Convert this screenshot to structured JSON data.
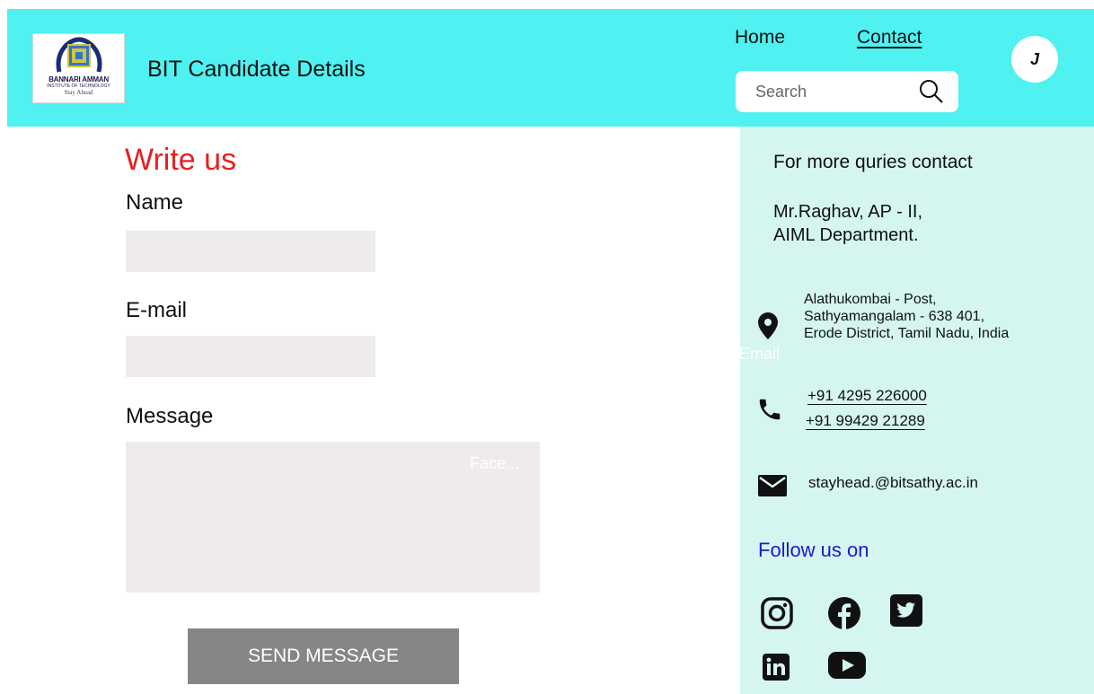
{
  "header": {
    "logo": {
      "line1": "BANNARI AMMAN",
      "line2": "INSTITUTE OF TECHNOLOGY",
      "line3": "Stay Ahead"
    },
    "title": "BIT Candidate Details",
    "nav": {
      "home": "Home",
      "contact": "Contact"
    },
    "avatar_initial": "J",
    "search": {
      "placeholder": "Search",
      "value": ""
    },
    "background_color": "#4ff1f1"
  },
  "form": {
    "title": "Write us",
    "name_label": "Name",
    "email_label": "E-mail",
    "message_label": "Message",
    "name_value": "",
    "email_value": "",
    "message_value": "",
    "message_overlay_text": "Face...",
    "submit_label": "SEND MESSAGE",
    "title_color": "#e8201f",
    "field_color": "#efebeb",
    "button_color": "#868686"
  },
  "contact": {
    "heading": "For more quries contact",
    "person_line1": "Mr.Raghav, AP - II,",
    "person_line2": "AIML Department.",
    "address_line1": "Alathukombai - Post,",
    "address_line2": "Sathyamangalam - 638 401,",
    "address_line3": "Erode District, Tamil Nadu, India",
    "email_overlay_text": "Email",
    "phone1": "+91 4295 226000",
    "phone2": "+91 99429 21289",
    "email": "stayhead.@bitsathy.ac.in",
    "follow_label": "Follow us on",
    "panel_color": "#d4f5f0",
    "follow_color": "#1a1acb",
    "icons": {
      "address": "location-pin-icon",
      "phone": "phone-icon",
      "email": "envelope-icon",
      "social": [
        "instagram-icon",
        "facebook-icon",
        "twitter-icon",
        "linkedin-icon",
        "youtube-icon"
      ]
    }
  }
}
